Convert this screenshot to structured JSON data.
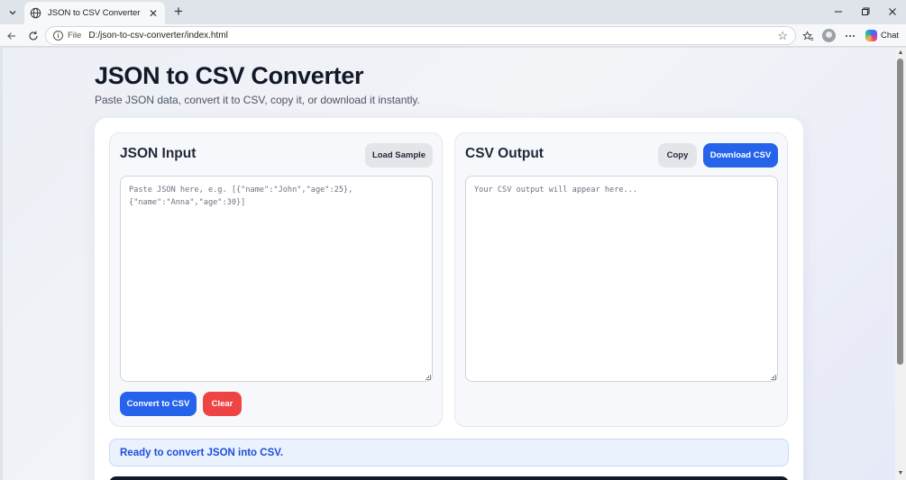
{
  "browser": {
    "tab_title": "JSON to CSV Converter",
    "url_scheme": "File",
    "url": "D:/json-to-csv-converter/index.html",
    "chat_label": "Chat"
  },
  "page": {
    "title": "JSON to CSV Converter",
    "subtitle": "Paste JSON data, convert it to CSV, copy it, or download it instantly."
  },
  "json_panel": {
    "title": "JSON Input",
    "load_sample_label": "Load Sample",
    "placeholder": "Paste JSON here, e.g. [{\"name\":\"John\",\"age\":25},\n{\"name\":\"Anna\",\"age\":30}]",
    "value": "",
    "convert_label": "Convert to CSV",
    "clear_label": "Clear"
  },
  "csv_panel": {
    "title": "CSV Output",
    "copy_label": "Copy",
    "download_label": "Download CSV",
    "placeholder": "Your CSV output will appear here...",
    "value": ""
  },
  "status": {
    "message": "Ready to convert JSON into CSV."
  },
  "colors": {
    "primary": "#2563eb",
    "danger": "#ef4444",
    "status_text": "#1d4ed8"
  }
}
